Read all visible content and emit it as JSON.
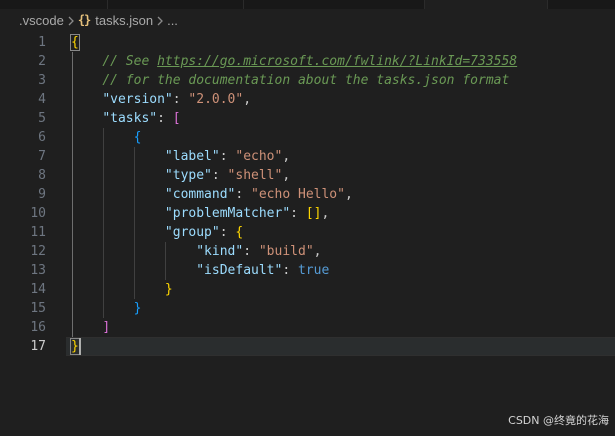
{
  "breadcrumb": {
    "folder": ".vscode",
    "file": "tasks.json",
    "ellipsis": "..."
  },
  "editor": {
    "line_numbers": [
      "1",
      "2",
      "3",
      "4",
      "5",
      "6",
      "7",
      "8",
      "9",
      "10",
      "11",
      "12",
      "13",
      "14",
      "15",
      "16",
      "17"
    ],
    "active_line": "17",
    "comment_prefix": "// See ",
    "comment_link": "https://go.microsoft.com/fwlink/?LinkId=733558",
    "comment2": "// for the documentation about the tasks.json format",
    "version_key": "\"version\"",
    "version_val": "\"2.0.0\"",
    "tasks_key": "\"tasks\"",
    "label_key": "\"label\"",
    "label_val": "\"echo\"",
    "type_key": "\"type\"",
    "type_val": "\"shell\"",
    "command_key": "\"command\"",
    "command_val": "\"echo Hello\"",
    "pm_key": "\"problemMatcher\"",
    "group_key": "\"group\"",
    "kind_key": "\"kind\"",
    "kind_val": "\"build\"",
    "isdefault_key": "\"isDefault\"",
    "isdefault_val": "true"
  },
  "watermark": "CSDN @终竟的花海",
  "colors": {
    "background": "#1f1f1f",
    "key": "#9cdcfe",
    "string": "#ce9178",
    "comment": "#6a9955",
    "bracket_gold": "#ffd700",
    "bracket_pink": "#da70d6",
    "bracket_blue": "#179fff",
    "boolean": "#569cd6"
  }
}
